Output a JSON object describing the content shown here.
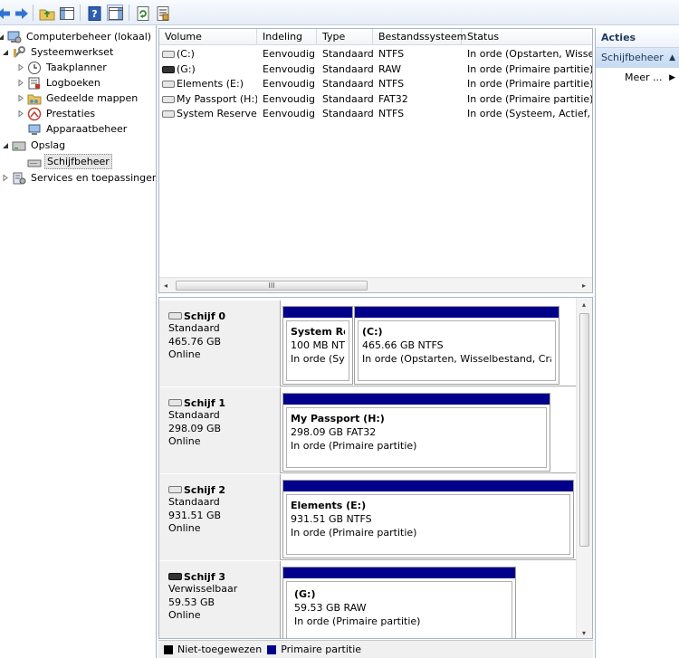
{
  "tree": {
    "root": "Computerbeheer (lokaal)",
    "system_tools": "Systeemwerkset",
    "task_scheduler": "Taakplanner",
    "event_viewer": "Logboeken",
    "shared_folders": "Gedeelde mappen",
    "performance": "Prestaties",
    "device_manager": "Apparaatbeheer",
    "storage": "Opslag",
    "disk_management": "Schijfbeheer",
    "services": "Services en toepassingen"
  },
  "volumes": {
    "columns": [
      "Volume",
      "Indeling",
      "Type",
      "Bestandssysteem",
      "Status"
    ],
    "rows": [
      {
        "volume": "(C:)",
        "layout": "Eenvoudig",
        "type": "Standaard",
        "fs": "NTFS",
        "status": "In orde (Opstarten, Wisselb"
      },
      {
        "volume": "(G:)",
        "layout": "Eenvoudig",
        "type": "Standaard",
        "fs": "RAW",
        "status": "In orde (Primaire partitie)"
      },
      {
        "volume": "Elements (E:)",
        "layout": "Eenvoudig",
        "type": "Standaard",
        "fs": "NTFS",
        "status": "In orde (Primaire partitie)"
      },
      {
        "volume": "My Passport (H:)",
        "layout": "Eenvoudig",
        "type": "Standaard",
        "fs": "FAT32",
        "status": "In orde (Primaire partitie)"
      },
      {
        "volume": "System Reserved",
        "layout": "Eenvoudig",
        "type": "Standaard",
        "fs": "NTFS",
        "status": "In orde (Systeem, Actief, Pr"
      }
    ],
    "scroll_grip": "III"
  },
  "disks": [
    {
      "name": "Schijf 0",
      "kind": "Standaard",
      "size": "465.76 GB",
      "state": "Online",
      "partitions": [
        {
          "name": "System Rese",
          "size": "100 MB NTFS",
          "status": "In orde (Syst"
        },
        {
          "name": "(C:)",
          "size": "465.66 GB NTFS",
          "status": "In orde (Opstarten, Wisselbestand, Crashd"
        }
      ]
    },
    {
      "name": "Schijf 1",
      "kind": "Standaard",
      "size": "298.09 GB",
      "state": "Online",
      "partitions": [
        {
          "name": "My Passport  (H:)",
          "size": "298.09 GB FAT32",
          "status": "In orde (Primaire partitie)"
        }
      ]
    },
    {
      "name": "Schijf 2",
      "kind": "Standaard",
      "size": "931.51 GB",
      "state": "Online",
      "partitions": [
        {
          "name": "Elements  (E:)",
          "size": "931.51 GB NTFS",
          "status": "In orde (Primaire partitie)"
        }
      ]
    },
    {
      "name": "Schijf 3",
      "kind": "Verwisselbaar",
      "size": "59.53 GB",
      "state": "Online",
      "partitions": [
        {
          "name": "(G:)",
          "size": "59.53 GB RAW",
          "status": "In orde (Primaire partitie)"
        }
      ]
    }
  ],
  "legend": {
    "unallocated": "Niet-toegewezen",
    "primary": "Primaire partitie",
    "unallocated_color": "#000000",
    "primary_color": "#00008b"
  },
  "actions": {
    "title": "Acties",
    "section": "Schijfbeheer",
    "more": "Meer ..."
  }
}
